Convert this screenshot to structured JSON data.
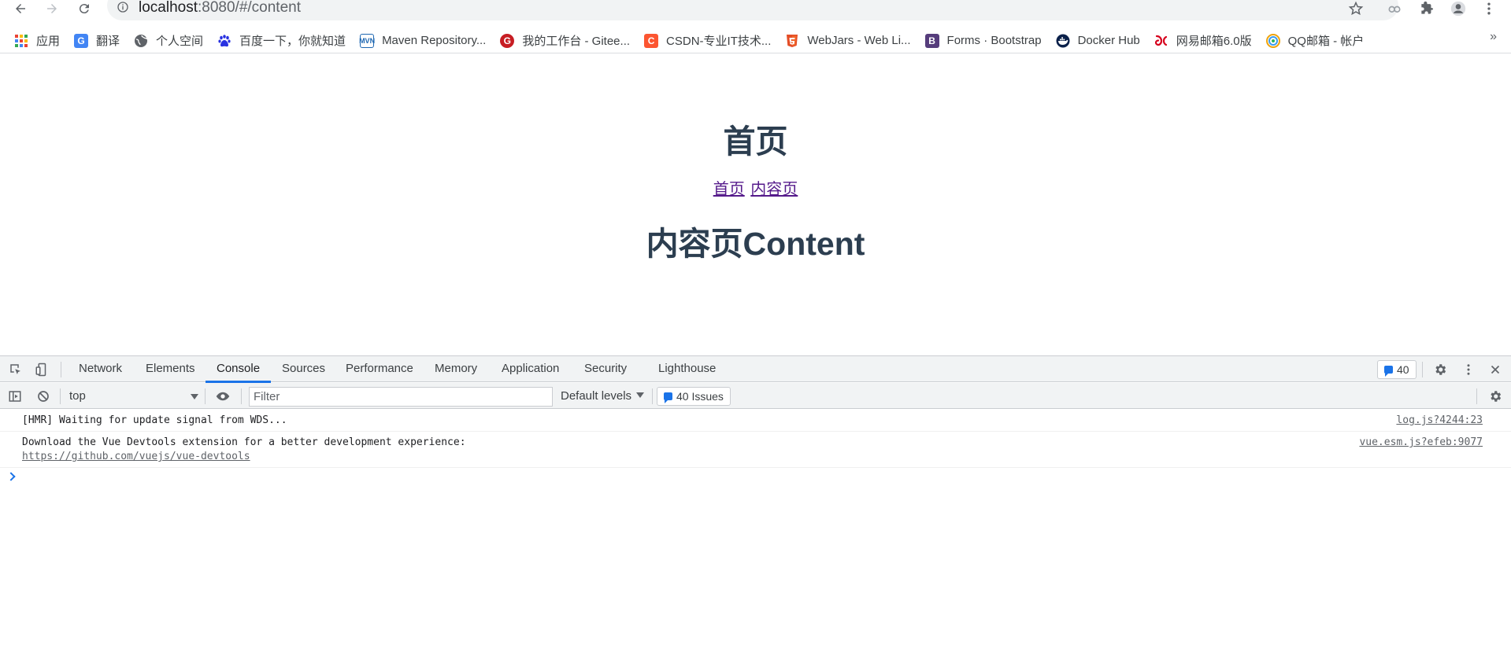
{
  "browser": {
    "url_host": "localhost",
    "url_path": ":8080/#/content",
    "bookmarks": [
      {
        "label": "应用",
        "icon": "apps-grid-icon"
      },
      {
        "label": "翻译",
        "icon": "translate-icon",
        "color": "#4285f4"
      },
      {
        "label": "个人空间",
        "icon": "globe-icon",
        "color": "#5f6368"
      },
      {
        "label": "百度一下，你就知道",
        "icon": "baidu-paw-icon",
        "color": "#2932e1"
      },
      {
        "label": "Maven Repository...",
        "icon": "maven-icon",
        "color": "#1d66b1"
      },
      {
        "label": "我的工作台 - Gitee...",
        "icon": "gitee-icon",
        "color": "#c71d23"
      },
      {
        "label": "CSDN-专业IT技术...",
        "icon": "csdn-icon",
        "color": "#fc5531"
      },
      {
        "label": "WebJars - Web Li...",
        "icon": "html5-shield-icon",
        "color": "#e44d26"
      },
      {
        "label": "Forms · Bootstrap",
        "icon": "bootstrap-icon",
        "color": "#563d7c"
      },
      {
        "label": "Docker Hub",
        "icon": "docker-icon",
        "color": "#0b214a"
      },
      {
        "label": "网易邮箱6.0版",
        "icon": "netease-mail-icon",
        "color": "#d6001c"
      },
      {
        "label": "QQ邮箱 - 帐户",
        "icon": "qq-mail-icon",
        "color": "#f0a30a"
      }
    ],
    "bookmarks_more": "»"
  },
  "page": {
    "title": "首页",
    "links": [
      "首页",
      "内容页"
    ],
    "subtitle": "内容页Content"
  },
  "devtools": {
    "tabs": [
      "Network",
      "Elements",
      "Console",
      "Sources",
      "Performance",
      "Memory",
      "Application",
      "Security",
      "Lighthouse"
    ],
    "active_tab": "Console",
    "messages_count": "40",
    "context": "top",
    "filter_placeholder": "Filter",
    "levels": "Default levels",
    "issues": "40 Issues",
    "logs": [
      {
        "text": "[HMR] Waiting for update signal from WDS...",
        "source": "log.js?4244:23"
      },
      {
        "text": "Download the Vue Devtools extension for a better development experience:",
        "link": "https://github.com/vuejs/vue-devtools",
        "source": "vue.esm.js?efeb:9077"
      }
    ],
    "accent": "#1a73e8"
  }
}
